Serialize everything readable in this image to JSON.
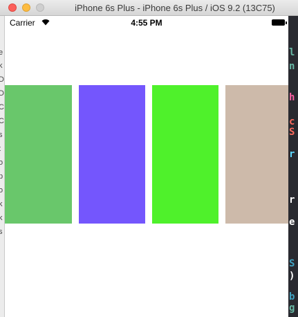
{
  "window": {
    "title": "iPhone 6s Plus - iPhone 6s Plus / iOS 9.2 (13C75)"
  },
  "status_bar": {
    "carrier": "Carrier",
    "time": "4:55 PM",
    "icons": [
      "wifi-icon",
      "battery-icon"
    ]
  },
  "tiles": [
    {
      "name": "green-tile",
      "color": "#69c76b"
    },
    {
      "name": "purple-tile",
      "color": "#7456fd"
    },
    {
      "name": "lime-tile",
      "color": "#4ff12b"
    },
    {
      "name": "tan-tile",
      "color": "#cdbaaa"
    }
  ]
}
